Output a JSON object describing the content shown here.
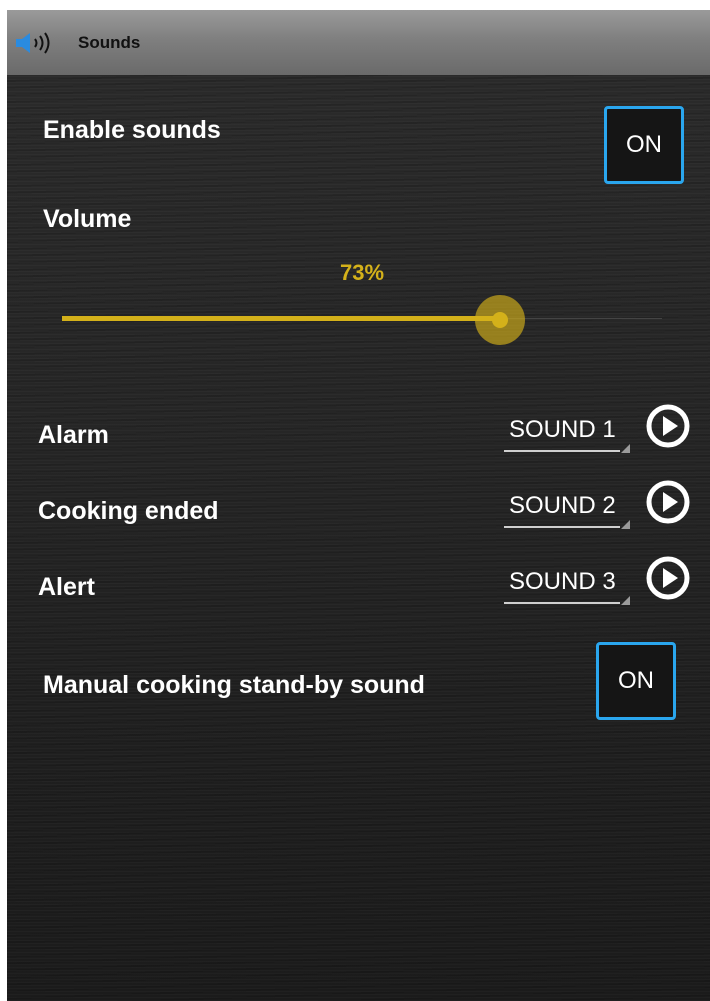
{
  "titlebar": {
    "title": "Sounds",
    "icon": "speaker-icon"
  },
  "enable_sounds": {
    "label": "Enable sounds",
    "toggle": "ON"
  },
  "volume": {
    "label": "Volume",
    "percent_text": "73%",
    "value": 0.73
  },
  "sounds": [
    {
      "label": "Alarm",
      "selected": "SOUND 1",
      "play_icon": "play-circle-icon"
    },
    {
      "label": "Cooking ended",
      "selected": "SOUND 2",
      "play_icon": "play-circle-icon"
    },
    {
      "label": "Alert",
      "selected": "SOUND 3",
      "play_icon": "play-circle-icon"
    }
  ],
  "standby": {
    "label": "Manual cooking stand-by sound",
    "toggle": "ON"
  },
  "colors": {
    "accent": "#d4b11a",
    "toggle_border": "#2aa6ee",
    "titlebar": "#808080"
  }
}
